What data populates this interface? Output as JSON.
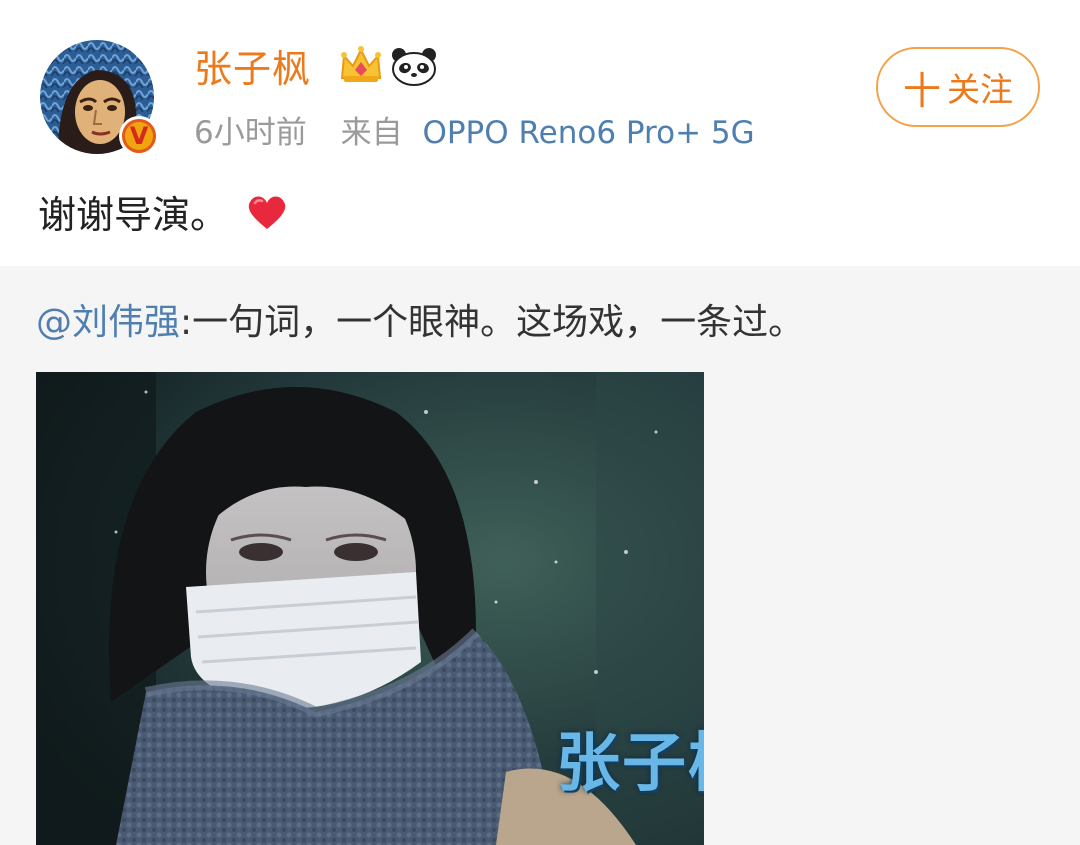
{
  "post": {
    "username": "张子枫",
    "time": "6小时前",
    "source_prefix": "来自",
    "device": "OPPO Reno6 Pro+ 5G",
    "follow_label": "关注",
    "follow_plus": "十",
    "text": "谢谢导演。",
    "badges": [
      "crown-icon",
      "panda-icon"
    ],
    "verified_badge": "V"
  },
  "repost": {
    "mention": "@刘伟强",
    "text": ":一句词，一个眼神。这场戏，一条过。",
    "image_caption": "张子枫"
  },
  "colors": {
    "username": "#ec7a1b",
    "link": "#4f7fb0",
    "meta": "#9a9a9a",
    "repost_bg": "#f5f5f5"
  }
}
